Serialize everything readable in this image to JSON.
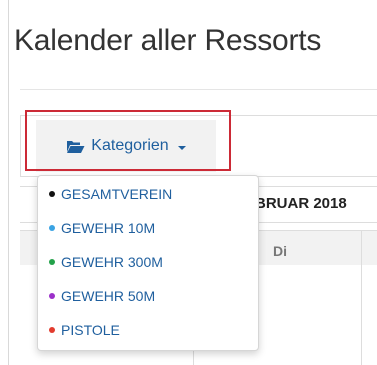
{
  "page": {
    "title": "Kalender aller Ressorts"
  },
  "toolbar": {
    "categories_label": "Kategorien",
    "icon": "folder-open-icon",
    "caret": "caret-down-icon",
    "accent": "#1f5f9e"
  },
  "highlight_color": "#cc2a36",
  "calendar": {
    "month_title": "BRUAR 2018",
    "weekday": "Di"
  },
  "dropdown": {
    "items": [
      {
        "label": "GESAMTVEREIN",
        "dot_color": "#111111"
      },
      {
        "label": "GEWEHR 10M",
        "dot_color": "#3aa3e3"
      },
      {
        "label": "GEWEHR 300M",
        "dot_color": "#23a14a"
      },
      {
        "label": "GEWEHR 50M",
        "dot_color": "#9b30c9"
      },
      {
        "label": "PISTOLE",
        "dot_color": "#e23b2e"
      }
    ]
  }
}
